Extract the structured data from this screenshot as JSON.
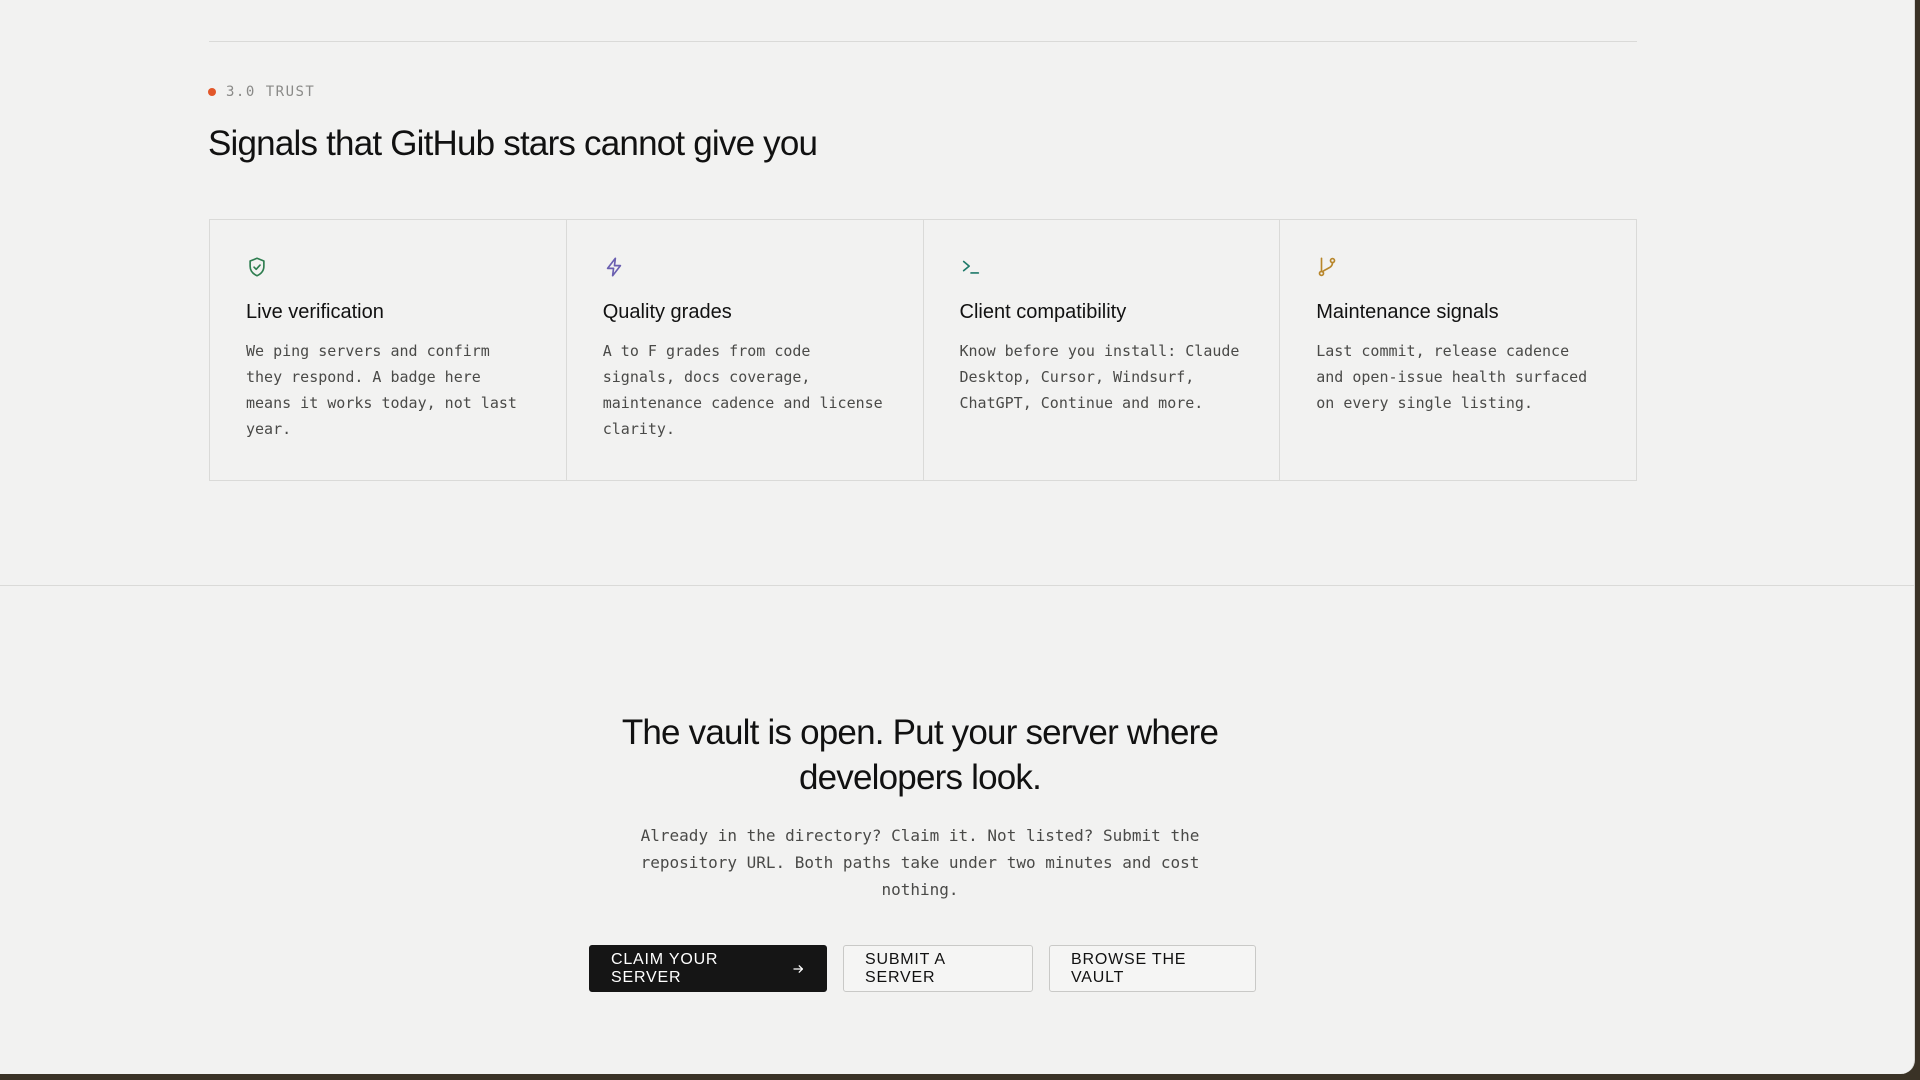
{
  "trust": {
    "eyebrow": "3.0 TRUST",
    "title": "Signals that GitHub stars cannot give you",
    "features": [
      {
        "icon": "shield-check-icon",
        "title": "Live verification",
        "description": "We ping servers and confirm they respond. A badge here means it works today, not last year."
      },
      {
        "icon": "lightning-icon",
        "title": "Quality grades",
        "description": "A to F grades from code signals, docs coverage, maintenance cadence and license clarity."
      },
      {
        "icon": "terminal-icon",
        "title": "Client compatibility",
        "description": "Know before you install: Claude Desktop, Cursor, Windsurf, ChatGPT, Continue and more."
      },
      {
        "icon": "git-branch-icon",
        "title": "Maintenance signals",
        "description": "Last commit, release cadence and open-issue health surfaced on every single listing."
      }
    ]
  },
  "cta": {
    "title": "The vault is open. Put your server where developers look.",
    "description": "Already in the directory? Claim it. Not listed? Submit the repository URL. Both paths take under two minutes and cost nothing.",
    "buttons": {
      "claim": "CLAIM YOUR SERVER",
      "submit": "SUBMIT A SERVER",
      "browse": "BROWSE THE VAULT"
    }
  },
  "colors": {
    "accent_dot": "#e2572a",
    "shield_icon": "#2e7d4f",
    "lightning_icon": "#6a5fb0",
    "terminal_icon": "#1f7a6a",
    "branch_icon": "#b8862b",
    "primary_button": "#151515"
  }
}
